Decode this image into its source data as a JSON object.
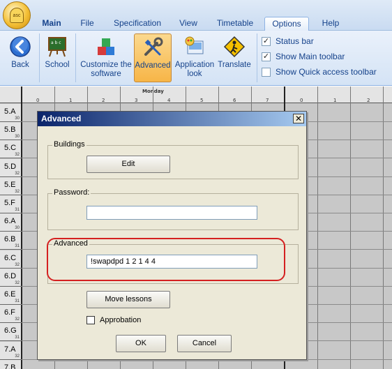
{
  "ribbon": {
    "tabs": [
      {
        "label": "Main"
      },
      {
        "label": "File"
      },
      {
        "label": "Specification"
      },
      {
        "label": "View"
      },
      {
        "label": "Timetable"
      },
      {
        "label": "Options"
      },
      {
        "label": "Help"
      }
    ],
    "active_tab": "Options",
    "buttons": {
      "back": "Back",
      "school": "School",
      "customize": "Customize the software",
      "advanced": "Advanced",
      "application_look": "Application look",
      "translate": "Translate"
    },
    "checkboxes": [
      {
        "label": "Status bar",
        "checked": true
      },
      {
        "label": "Show Main toolbar",
        "checked": true
      },
      {
        "label": "Show Quick access toolbar",
        "checked": false
      }
    ]
  },
  "timetable": {
    "day": "Monday",
    "periods_left": [
      "0",
      "1",
      "2",
      "3",
      "4",
      "5",
      "6",
      "7"
    ],
    "periods_right": [
      "0",
      "1",
      "2"
    ],
    "rows": [
      {
        "cls": "5.A",
        "count": "30"
      },
      {
        "cls": "5.B",
        "count": "30"
      },
      {
        "cls": "5.C",
        "count": "32"
      },
      {
        "cls": "5.D",
        "count": "32"
      },
      {
        "cls": "5.E",
        "count": "32"
      },
      {
        "cls": "5.F",
        "count": "31"
      },
      {
        "cls": "6.A",
        "count": "30"
      },
      {
        "cls": "6.B",
        "count": "31"
      },
      {
        "cls": "6.C",
        "count": "32"
      },
      {
        "cls": "6.D",
        "count": "32"
      },
      {
        "cls": "6.E",
        "count": "31"
      },
      {
        "cls": "6.F",
        "count": "32"
      },
      {
        "cls": "6.G",
        "count": "31"
      },
      {
        "cls": "7.A",
        "count": "32"
      },
      {
        "cls": "7.B",
        "count": ""
      }
    ]
  },
  "dialog": {
    "title": "Advanced",
    "close": "✕",
    "buildings_label": "Buildings",
    "edit_button": "Edit",
    "password_label": "Password:",
    "password_value": "",
    "advanced_label": "Advanced",
    "advanced_value": "!swapdpd 1 2 1 4 4",
    "move_lessons_button": "Move lessons",
    "approbation_label": "Approbation",
    "approbation_checked": false,
    "ok_button": "OK",
    "cancel_button": "Cancel"
  }
}
